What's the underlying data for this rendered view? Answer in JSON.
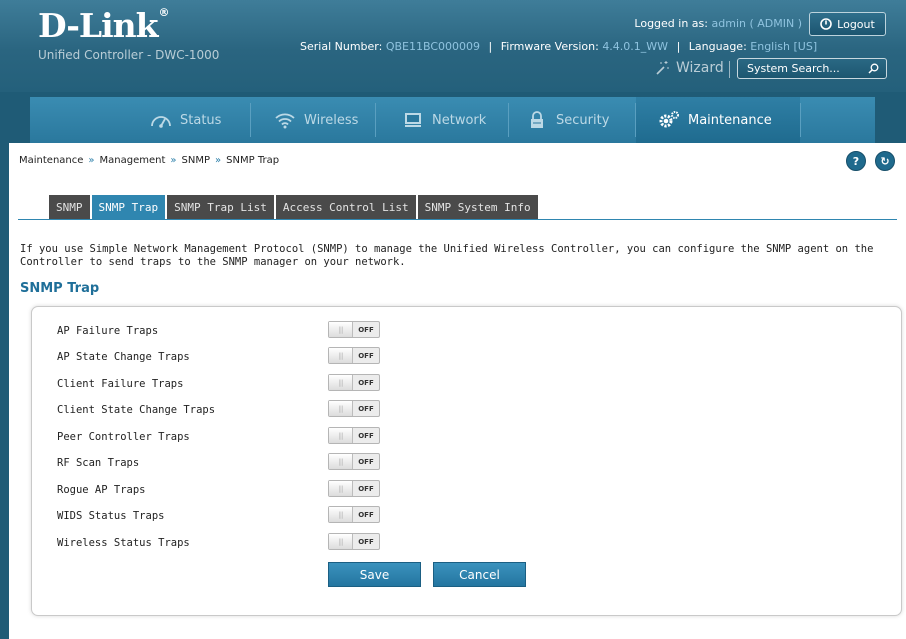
{
  "header": {
    "logo_text": "D-Link",
    "logo_mark": "®",
    "subtitle": "Unified Controller - DWC-1000",
    "logged_in_label": "Logged in as:",
    "user": "admin ( ADMIN )",
    "logout_label": "Logout",
    "serial_label": "Serial Number:",
    "serial_value": "QBE11BC000009",
    "firmware_label": "Firmware Version:",
    "firmware_value": "4.4.0.1_WW",
    "language_label": "Language:",
    "language_value": "English [US]",
    "wizard_label": "Wizard",
    "search_placeholder": "System Search..."
  },
  "nav": {
    "items": [
      {
        "label": "Status",
        "icon": "gauge-icon"
      },
      {
        "label": "Wireless",
        "icon": "wifi-icon"
      },
      {
        "label": "Network",
        "icon": "monitor-icon"
      },
      {
        "label": "Security",
        "icon": "lock-icon"
      },
      {
        "label": "Maintenance",
        "icon": "gears-icon",
        "active": true
      }
    ]
  },
  "breadcrumb": {
    "items": [
      "Maintenance",
      "Management",
      "SNMP",
      "SNMP Trap"
    ],
    "separator": "»"
  },
  "tabs": [
    {
      "label": "SNMP"
    },
    {
      "label": "SNMP Trap",
      "active": true
    },
    {
      "label": "SNMP Trap List"
    },
    {
      "label": "Access Control List"
    },
    {
      "label": "SNMP System Info"
    }
  ],
  "description": "If you use Simple Network Management Protocol (SNMP) to manage the Unified Wireless Controller, you can configure the SNMP agent on the Controller to send traps to the SNMP manager on your network.",
  "section_title": "SNMP Trap",
  "traps": [
    {
      "label": "AP Failure Traps",
      "state": "OFF"
    },
    {
      "label": "AP State Change Traps",
      "state": "OFF"
    },
    {
      "label": "Client Failure Traps",
      "state": "OFF"
    },
    {
      "label": "Client State Change Traps",
      "state": "OFF"
    },
    {
      "label": "Peer Controller Traps",
      "state": "OFF"
    },
    {
      "label": "RF Scan Traps",
      "state": "OFF"
    },
    {
      "label": "Rogue AP Traps",
      "state": "OFF"
    },
    {
      "label": "WIDS Status Traps",
      "state": "OFF"
    },
    {
      "label": "Wireless Status Traps",
      "state": "OFF"
    }
  ],
  "toggle_grip": "|||",
  "buttons": {
    "save": "Save",
    "cancel": "Cancel"
  },
  "help_buttons": {
    "help": "?",
    "refresh": "↻"
  },
  "colors": {
    "accent": "#2f86b0",
    "header": "#2a6580",
    "nav": "#3a8cb2",
    "link": "#8fc3df"
  }
}
